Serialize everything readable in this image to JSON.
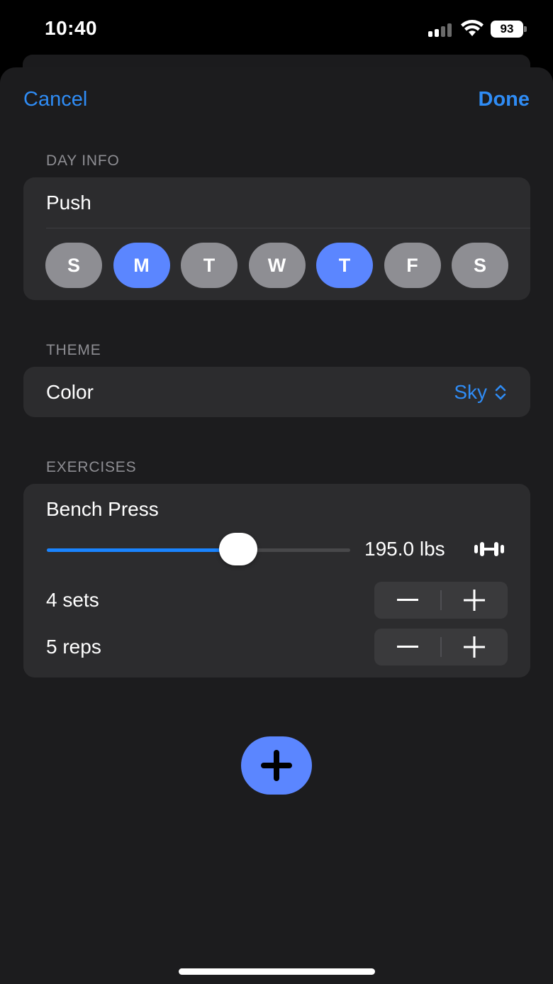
{
  "status_bar": {
    "time": "10:40",
    "battery": "93"
  },
  "nav": {
    "cancel": "Cancel",
    "done": "Done"
  },
  "day_info": {
    "header": "DAY INFO",
    "name": "Push",
    "days": [
      {
        "label": "S",
        "selected": false
      },
      {
        "label": "M",
        "selected": true
      },
      {
        "label": "T",
        "selected": false
      },
      {
        "label": "W",
        "selected": false
      },
      {
        "label": "T",
        "selected": true
      },
      {
        "label": "F",
        "selected": false
      },
      {
        "label": "S",
        "selected": false
      }
    ]
  },
  "theme": {
    "header": "THEME",
    "label": "Color",
    "value": "Sky"
  },
  "exercises": {
    "header": "EXERCISES",
    "items": [
      {
        "name": "Bench Press",
        "weight": "195.0 lbs",
        "slider_fraction": 0.63,
        "sets": "4 sets",
        "reps": "5 reps"
      }
    ]
  },
  "colors": {
    "accent": "#2f8cf5",
    "selected_day": "#5b86ff",
    "unselected_day": "#8e8e93",
    "slider_fill": "#1a84ff",
    "sheet_bg": "#1c1c1e",
    "group_bg": "#2c2c2e"
  },
  "icons": [
    "cellular-signal-icon",
    "wifi-icon",
    "battery-icon",
    "chevron-up-down-icon",
    "dumbbell-icon",
    "minus-icon",
    "plus-icon",
    "add-exercise-plus-icon"
  ]
}
